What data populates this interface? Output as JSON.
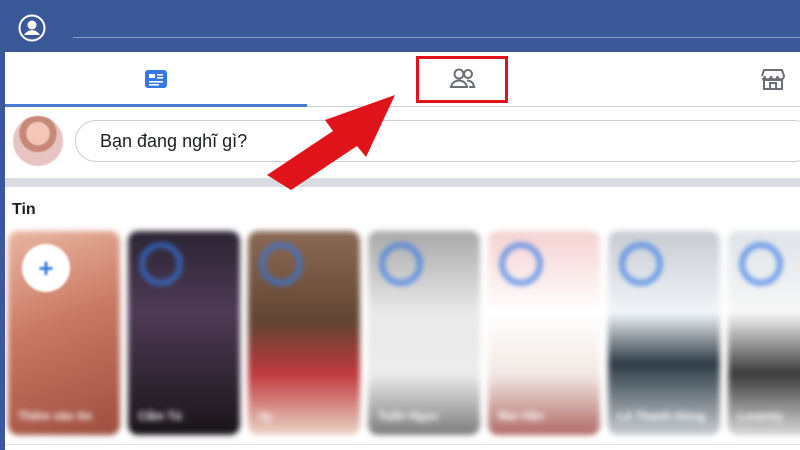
{
  "composer": {
    "status_placeholder": "Bạn đang nghĩ gì?"
  },
  "stories": {
    "title": "Tin",
    "cards": [
      {
        "name": "Thêm vào tin"
      },
      {
        "name": "Cẩm Tú"
      },
      {
        "name": "Vy"
      },
      {
        "name": "Tuấn Ngọc"
      },
      {
        "name": "Mai Hân"
      },
      {
        "name": "Lê Thanh Hùng"
      },
      {
        "name": "Leventy"
      }
    ]
  },
  "icons": {
    "profile": "user-circle-icon",
    "home": "news-feed-icon",
    "friends": "friends-icon",
    "marketplace": "marketplace-icon",
    "add_story": "plus-icon"
  },
  "colors": {
    "brand": "#3b5998",
    "active_tab": "#4a7bd1",
    "annotation": "#e1131a",
    "story_ring": "#3578e5"
  }
}
